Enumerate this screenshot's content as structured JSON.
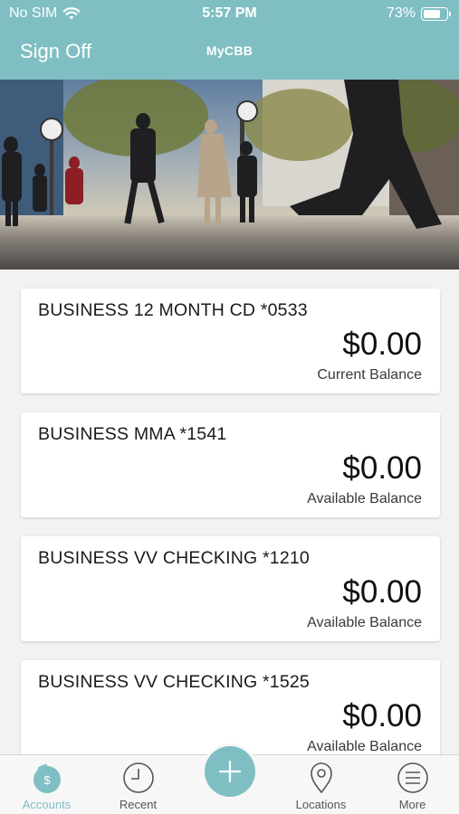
{
  "status_bar": {
    "carrier": "No SIM",
    "time": "5:57 PM",
    "battery_percent": "73%",
    "battery_level": 0.73
  },
  "nav": {
    "sign_off_label": "Sign Off",
    "title": "MyCBB"
  },
  "accounts": [
    {
      "name": "BUSINESS 12 MONTH CD *0533",
      "balance": "$0.00",
      "balance_label": "Current Balance"
    },
    {
      "name": "BUSINESS MMA *1541",
      "balance": "$0.00",
      "balance_label": "Available Balance"
    },
    {
      "name": "BUSINESS VV CHECKING *1210",
      "balance": "$0.00",
      "balance_label": "Available Balance"
    },
    {
      "name": "BUSINESS VV CHECKING *1525",
      "balance": "$0.00",
      "balance_label": "Available Balance"
    }
  ],
  "tab_bar": {
    "tabs": [
      {
        "label": "Accounts",
        "icon": "dollar-coin-icon",
        "active": true
      },
      {
        "label": "Recent",
        "icon": "clock-icon",
        "active": false
      },
      {
        "label": "Locations",
        "icon": "map-pin-icon",
        "active": false
      },
      {
        "label": "More",
        "icon": "menu-icon",
        "active": false
      }
    ],
    "fab_icon": "plus-icon"
  },
  "colors": {
    "accent": "#7fbfc3",
    "background": "#f2f2f2",
    "card": "#ffffff"
  }
}
